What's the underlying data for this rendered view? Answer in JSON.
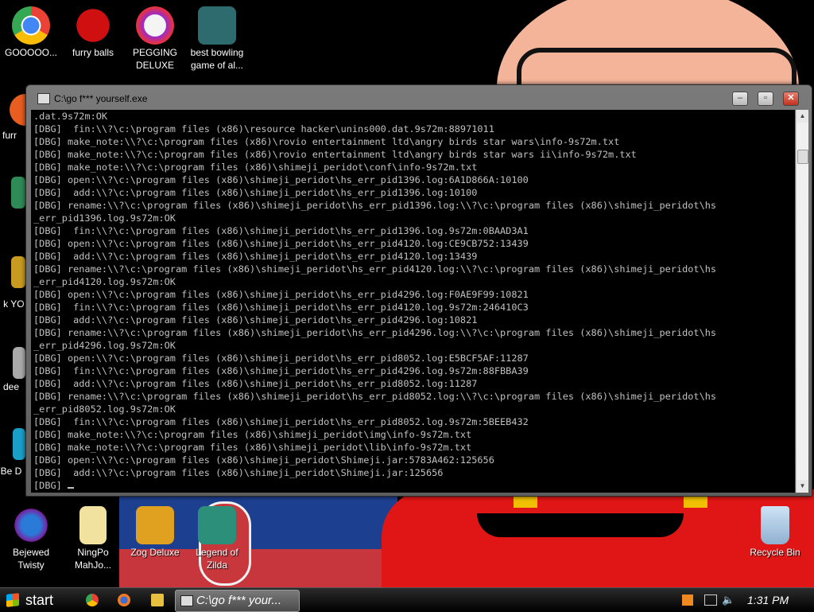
{
  "desktop": {
    "top_icons": [
      {
        "label": "GOOOOO..."
      },
      {
        "label": "furry balls"
      },
      {
        "label": "PEGGING DELUXE"
      },
      {
        "label": "best bowling game of al..."
      }
    ],
    "side_partial": [
      "furr",
      "I k YO",
      "dee",
      "Be D"
    ],
    "bottom_icons": [
      {
        "label": "Bejewed Twisty"
      },
      {
        "label": "NingPo MahJo..."
      },
      {
        "label": "Zog Deluxe"
      },
      {
        "label": "Legend of Zilda"
      },
      {
        "label": "Recycle Bin"
      }
    ]
  },
  "window": {
    "title": "C:\\go f*** yourself.exe",
    "buttons": {
      "minimize": "–",
      "maximize": "▫",
      "close": "✕"
    }
  },
  "console": {
    "lines": [
      ".dat.9s72m:OK",
      "[DBG]  fin:\\\\?\\c:\\program files (x86)\\resource hacker\\unins000.dat.9s72m:88971011",
      "[DBG] make_note:\\\\?\\c:\\program files (x86)\\rovio entertainment ltd\\angry birds star wars\\info-9s72m.txt",
      "[DBG] make_note:\\\\?\\c:\\program files (x86)\\rovio entertainment ltd\\angry birds star wars ii\\info-9s72m.txt",
      "[DBG] make_note:\\\\?\\c:\\program files (x86)\\shimeji_peridot\\conf\\info-9s72m.txt",
      "[DBG] open:\\\\?\\c:\\program files (x86)\\shimeji_peridot\\hs_err_pid1396.log:6A1D866A:10100",
      "[DBG]  add:\\\\?\\c:\\program files (x86)\\shimeji_peridot\\hs_err_pid1396.log:10100",
      "[DBG] rename:\\\\?\\c:\\program files (x86)\\shimeji_peridot\\hs_err_pid1396.log:\\\\?\\c:\\program files (x86)\\shimeji_peridot\\hs",
      "_err_pid1396.log.9s72m:OK",
      "[DBG]  fin:\\\\?\\c:\\program files (x86)\\shimeji_peridot\\hs_err_pid1396.log.9s72m:0BAAD3A1",
      "[DBG] open:\\\\?\\c:\\program files (x86)\\shimeji_peridot\\hs_err_pid4120.log:CE9CB752:13439",
      "[DBG]  add:\\\\?\\c:\\program files (x86)\\shimeji_peridot\\hs_err_pid4120.log:13439",
      "[DBG] rename:\\\\?\\c:\\program files (x86)\\shimeji_peridot\\hs_err_pid4120.log:\\\\?\\c:\\program files (x86)\\shimeji_peridot\\hs",
      "_err_pid4120.log.9s72m:OK",
      "[DBG] open:\\\\?\\c:\\program files (x86)\\shimeji_peridot\\hs_err_pid4296.log:F0AE9F99:10821",
      "[DBG]  fin:\\\\?\\c:\\program files (x86)\\shimeji_peridot\\hs_err_pid4120.log.9s72m:246410C3",
      "[DBG]  add:\\\\?\\c:\\program files (x86)\\shimeji_peridot\\hs_err_pid4296.log:10821",
      "[DBG] rename:\\\\?\\c:\\program files (x86)\\shimeji_peridot\\hs_err_pid4296.log:\\\\?\\c:\\program files (x86)\\shimeji_peridot\\hs",
      "_err_pid4296.log.9s72m:OK",
      "[DBG] open:\\\\?\\c:\\program files (x86)\\shimeji_peridot\\hs_err_pid8052.log:E5BCF5AF:11287",
      "[DBG]  fin:\\\\?\\c:\\program files (x86)\\shimeji_peridot\\hs_err_pid4296.log.9s72m:88FBBA39",
      "[DBG]  add:\\\\?\\c:\\program files (x86)\\shimeji_peridot\\hs_err_pid8052.log:11287",
      "[DBG] rename:\\\\?\\c:\\program files (x86)\\shimeji_peridot\\hs_err_pid8052.log:\\\\?\\c:\\program files (x86)\\shimeji_peridot\\hs",
      "_err_pid8052.log.9s72m:OK",
      "[DBG]  fin:\\\\?\\c:\\program files (x86)\\shimeji_peridot\\hs_err_pid8052.log.9s72m:5BEEB432",
      "[DBG] make_note:\\\\?\\c:\\program files (x86)\\shimeji_peridot\\img\\info-9s72m.txt",
      "[DBG] make_note:\\\\?\\c:\\program files (x86)\\shimeji_peridot\\lib\\info-9s72m.txt",
      "[DBG] open:\\\\?\\c:\\program files (x86)\\shimeji_peridot\\Shimeji.jar:5783A462:125656",
      "[DBG]  add:\\\\?\\c:\\program files (x86)\\shimeji_peridot\\Shimeji.jar:125656"
    ],
    "prompt": "[DBG] "
  },
  "taskbar": {
    "start_label": "start",
    "active_task": "C:\\go f*** your...",
    "clock": "1:31 PM"
  }
}
